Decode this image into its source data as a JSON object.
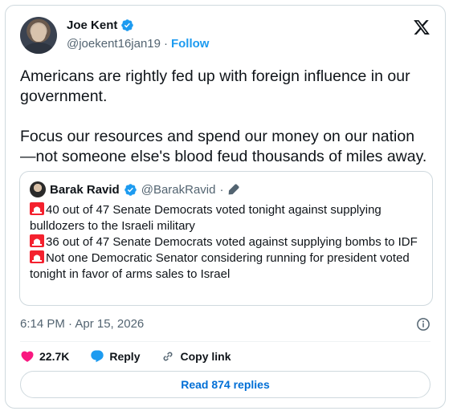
{
  "author": {
    "name": "Joe Kent",
    "handle": "@joekent16jan19",
    "separator": "·",
    "follow_label": "Follow"
  },
  "tweet": {
    "text": "Americans are rightly fed up with foreign influence in our government.\n\nFocus our resources and spend our money on our nation—not someone else's blood feud thousands of miles away.",
    "timestamp": "6:14 PM · Apr 15, 2026"
  },
  "quote": {
    "name": "Barak Ravid",
    "handle": "@BarakRavid",
    "separator": "·",
    "lines": [
      "40 out of 47 Senate Democrats voted tonight against supplying bulldozers to the Israeli military",
      "36 out of 47 Senate Democrats voted against supplying bombs to IDF",
      "Not one Democratic Senator considering running for president voted tonight in favor of arms sales to Israel"
    ]
  },
  "actions": {
    "likes": "22.7K",
    "reply_label": "Reply",
    "copy_label": "Copy link"
  },
  "replies_button": "Read 874 replies",
  "colors": {
    "accent": "#1d9bf0",
    "like": "#f91880",
    "siren": "#f4212e",
    "verified": "#1d9bf0"
  },
  "icons": [
    "verified-badge-icon",
    "x-logo-icon",
    "pencil-icon",
    "siren-icon",
    "info-icon",
    "heart-icon",
    "reply-bubble-icon",
    "link-icon"
  ]
}
